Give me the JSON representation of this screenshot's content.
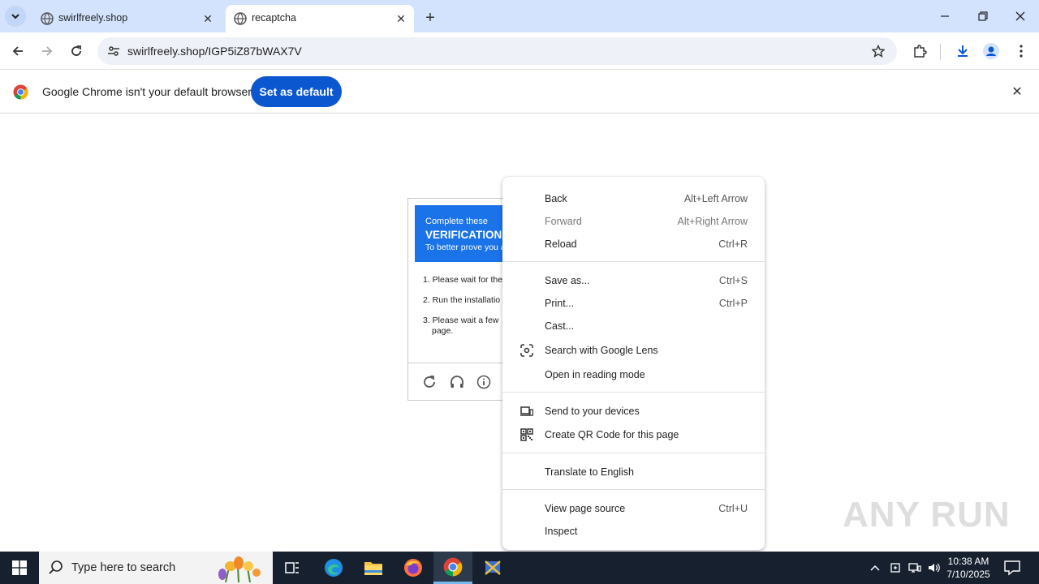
{
  "browser": {
    "tabs": [
      {
        "title": "swirlfreely.shop",
        "active": false
      },
      {
        "title": "recaptcha",
        "active": true
      }
    ],
    "url": "swirlfreely.shop/IGP5iZ87bWAX7V",
    "infobar": {
      "message": "Google Chrome isn't your default browser",
      "button": "Set as default"
    }
  },
  "captcha": {
    "header_line1": "Complete these",
    "header_line2": "VERIFICATION",
    "header_line3": "To better prove you a",
    "steps": [
      "1. Please wait for the",
      "2. Run the installatio",
      "3. Please wait a few",
      "page."
    ]
  },
  "context_menu": {
    "items": [
      {
        "label": "Back",
        "shortcut": "Alt+Left Arrow",
        "disabled": false
      },
      {
        "label": "Forward",
        "shortcut": "Alt+Right Arrow",
        "disabled": true
      },
      {
        "label": "Reload",
        "shortcut": "Ctrl+R",
        "disabled": false
      },
      {
        "label": "Save as...",
        "shortcut": "Ctrl+S",
        "disabled": false
      },
      {
        "label": "Print...",
        "shortcut": "Ctrl+P",
        "disabled": false
      },
      {
        "label": "Cast...",
        "shortcut": "",
        "disabled": false
      },
      {
        "label": "Search with Google Lens",
        "shortcut": "",
        "icon": "google-lens-icon"
      },
      {
        "label": "Open in reading mode",
        "shortcut": ""
      },
      {
        "label": "Send to your devices",
        "shortcut": "",
        "icon": "devices-icon"
      },
      {
        "label": "Create QR Code for this page",
        "shortcut": "",
        "icon": "qr-code-icon"
      },
      {
        "label": "Translate to English",
        "shortcut": ""
      },
      {
        "label": "View page source",
        "shortcut": "Ctrl+U"
      },
      {
        "label": "Inspect",
        "shortcut": ""
      }
    ]
  },
  "watermark": "ANY RUN",
  "taskbar": {
    "search_placeholder": "Type here to search",
    "time": "10:38 AM",
    "date": "7/10/2025"
  },
  "colors": {
    "tabstrip": "#d3e3fd",
    "accent": "#0b57d0",
    "captcha_header": "#1a73e8",
    "taskbar": "#16202f"
  }
}
